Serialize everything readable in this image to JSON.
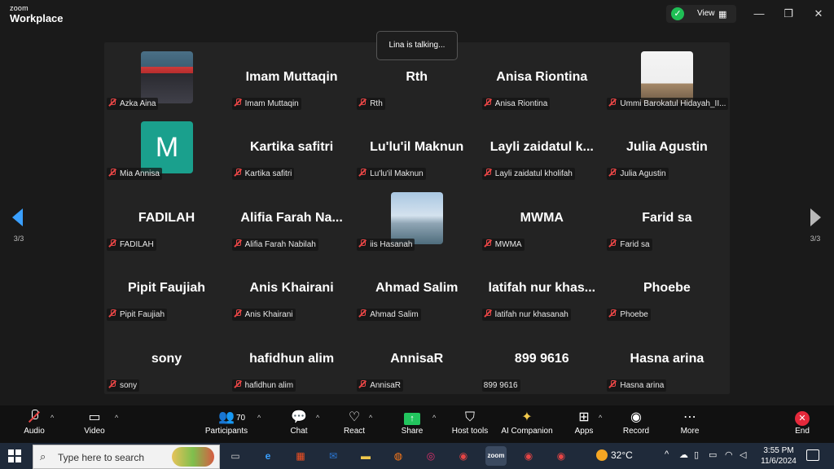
{
  "app": {
    "brand_small": "zoom",
    "brand_big": "Workplace"
  },
  "header": {
    "view_label": "View"
  },
  "nav": {
    "page_left": "3/3",
    "page_right": "3/3"
  },
  "toast": "Lina is talking...",
  "participants": [
    {
      "name": "Azka Aina",
      "display": "",
      "avatar": "photo-capred"
    },
    {
      "name": "Imam Muttaqin",
      "display": "Imam Muttaqin"
    },
    {
      "name": "Rth",
      "display": "Rth"
    },
    {
      "name": "Anisa Riontina",
      "display": "Anisa Riontina"
    },
    {
      "name": "Ummi Barokatul Hidayah_II...",
      "display": "",
      "avatar": "photo-doc"
    },
    {
      "name": "Mia Annisa",
      "display": "",
      "avatar": "letter-m",
      "letter": "M"
    },
    {
      "name": "Kartika safitri",
      "display": "Kartika safitri"
    },
    {
      "name": "Lu'lu'il Maknun",
      "display": "Lu'lu'il Maknun"
    },
    {
      "name": "Layli zaidatul kholifah",
      "display": "Layli zaidatul k..."
    },
    {
      "name": "Julia Agustin",
      "display": "Julia Agustin"
    },
    {
      "name": "FADILAH",
      "display": "FADILAH"
    },
    {
      "name": "Alifia Farah Nabilah",
      "display": "Alifia Farah Na..."
    },
    {
      "name": "iis Hasanah",
      "display": "",
      "avatar": "photo-sea"
    },
    {
      "name": "MWMA",
      "display": "MWMA"
    },
    {
      "name": "Farid sa",
      "display": "Farid sa"
    },
    {
      "name": "Pipit Faujiah",
      "display": "Pipit Faujiah"
    },
    {
      "name": "Anis Khairani",
      "display": "Anis Khairani"
    },
    {
      "name": "Ahmad Salim",
      "display": "Ahmad Salim"
    },
    {
      "name": "latifah nur khasanah",
      "display": "latifah nur khas..."
    },
    {
      "name": "Phoebe",
      "display": "Phoebe"
    },
    {
      "name": "sony",
      "display": "sony"
    },
    {
      "name": "hafidhun alim",
      "display": "hafidhun alim"
    },
    {
      "name": "AnnisaR",
      "display": "AnnisaR"
    },
    {
      "name": "899 9616",
      "display": "899 9616",
      "mic": false
    },
    {
      "name": "Hasna arina",
      "display": "Hasna arina"
    }
  ],
  "toolbar": {
    "audio": "Audio",
    "video": "Video",
    "participants": "Participants",
    "participants_count": "70",
    "chat": "Chat",
    "react": "React",
    "share": "Share",
    "host_tools": "Host tools",
    "ai_companion": "AI Companion",
    "apps": "Apps",
    "record": "Record",
    "more": "More",
    "end": "End"
  },
  "taskbar": {
    "search_placeholder": "Type here to search",
    "temperature": "32°C",
    "time": "3:55 PM",
    "date": "11/6/2024"
  },
  "colors": {
    "accent_blue": "#3aa0ff",
    "share_green": "#22c55e",
    "end_red": "#e5293b",
    "mic_red": "#e64545",
    "avatar_teal": "#1aa08d"
  }
}
